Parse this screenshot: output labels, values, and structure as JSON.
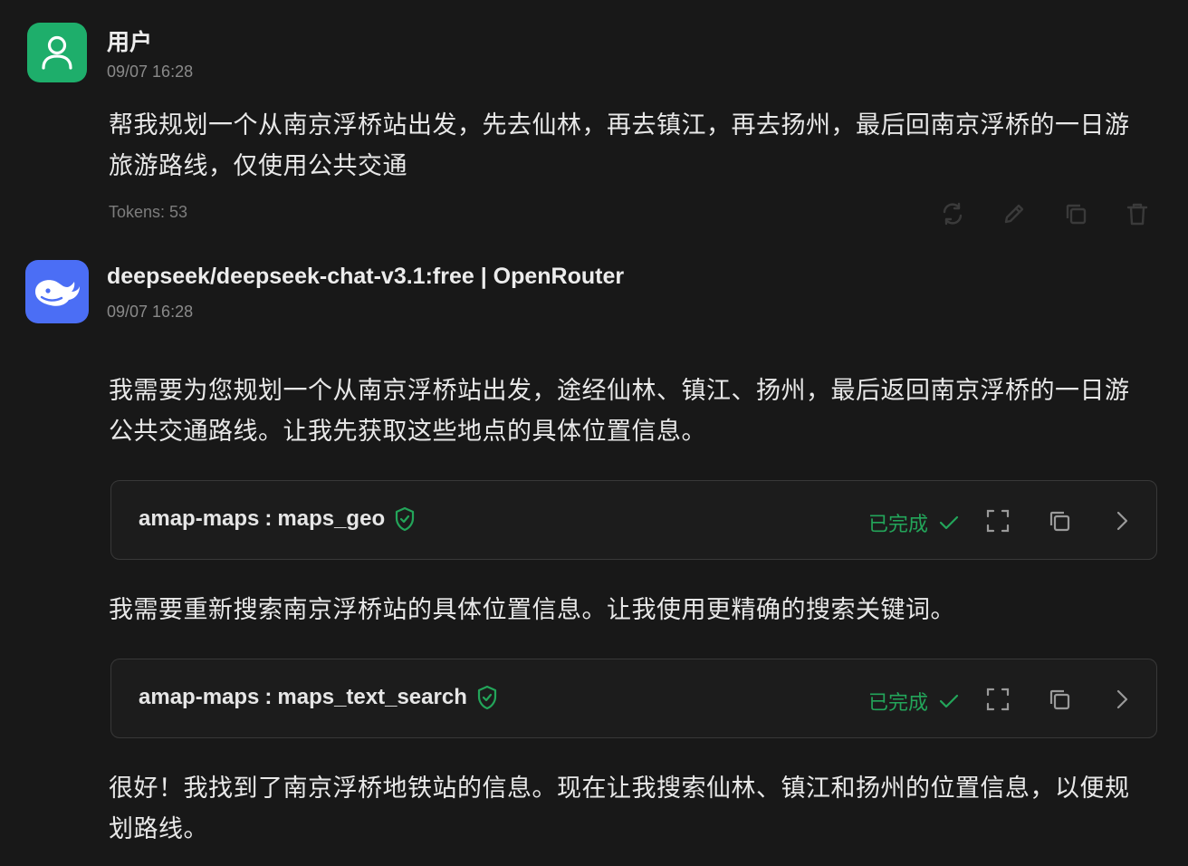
{
  "colors": {
    "background": "#181818",
    "user_avatar": "#1eae6b",
    "bot_avatar": "#4b6ef5",
    "status_done": "#23a55a"
  },
  "user_message": {
    "sender": "用户",
    "time": "09/07 16:28",
    "text_lines": [
      "帮我规划一个从南京浮桥站出发，先去仙林，再去镇江，再去扬州，最后回南京浮桥的一日游",
      "旅游路线，仅使用公共交通"
    ],
    "tokens": "Tokens: 53",
    "actions": [
      "refresh-icon",
      "edit-icon",
      "copy-icon",
      "delete-icon"
    ]
  },
  "assistant_message": {
    "sender": "deepseek/deepseek-chat-v3.1:free | OpenRouter",
    "time": "09/07 16:28",
    "paragraph1_lines": [
      "我需要为您规划一个从南京浮桥站出发，途经仙林、镇江、扬州，最后返回南京浮桥的一日游",
      "公共交通路线。让我先获取这些地点的具体位置信息。"
    ],
    "tool_calls": [
      {
        "server": "amap-maps",
        "separator": ":",
        "tool": "maps_geo",
        "status": "已完成"
      },
      {
        "server": "amap-maps",
        "separator": ":",
        "tool": "maps_text_search",
        "status": "已完成"
      }
    ],
    "paragraph2": "我需要重新搜索南京浮桥站的具体位置信息。让我使用更精确的搜索关键词。",
    "paragraph3_lines": [
      "很好！我找到了南京浮桥地铁站的信息。现在让我搜索仙林、镇江和扬州的位置信息，以便规",
      "划路线。"
    ]
  }
}
